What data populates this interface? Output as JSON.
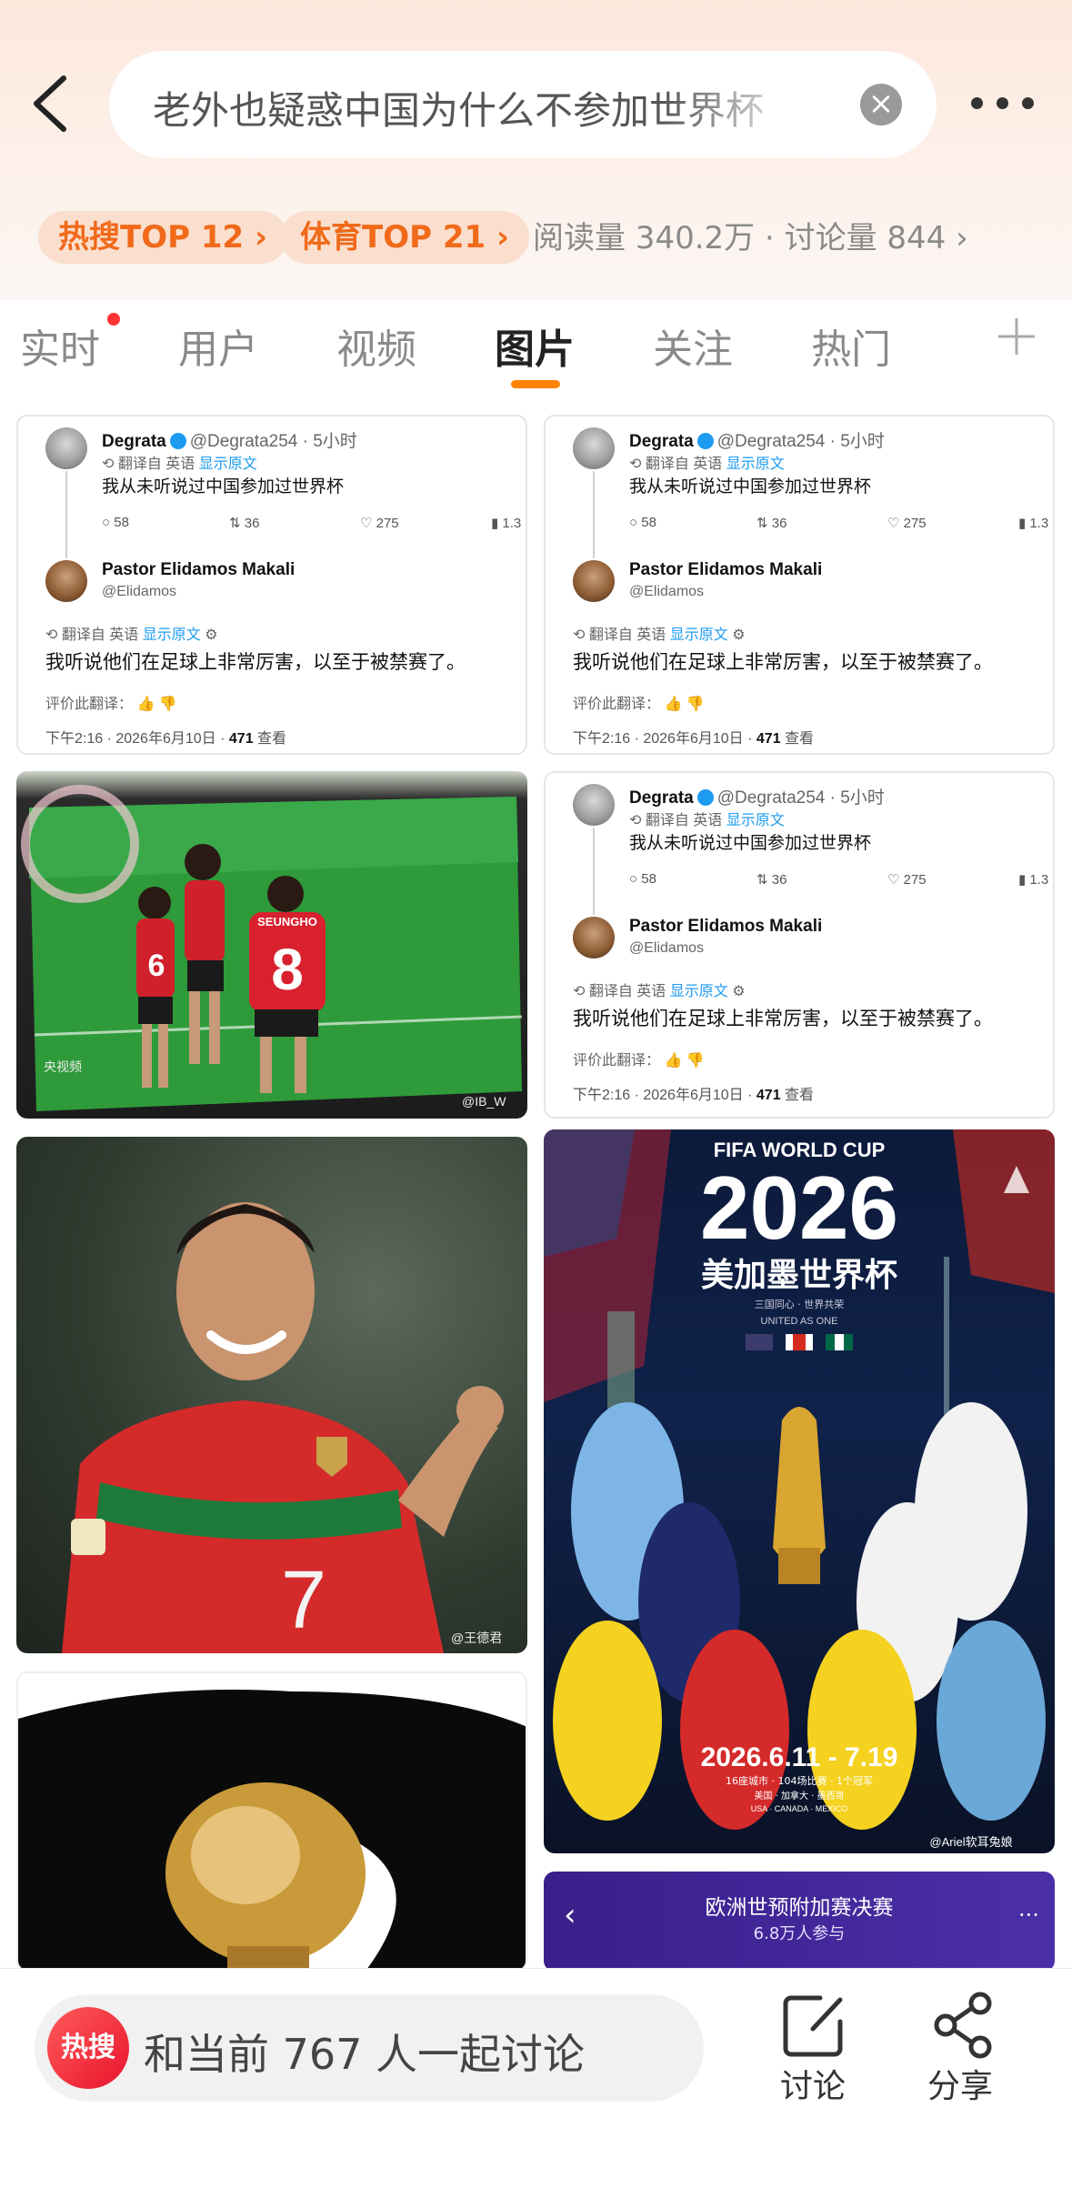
{
  "search": {
    "query": "老外也疑惑中国为什么不参加世界杯"
  },
  "tags": {
    "hot_search": "热搜TOP 12",
    "sports": "体育TOP 21"
  },
  "stats": "阅读量 340.2万 · 讨论量 844",
  "tabs": [
    "实时",
    "用户",
    "视频",
    "图片",
    "关注",
    "热门"
  ],
  "active_tab": "图片",
  "tweet": {
    "user1_name": "Degrata",
    "user1_handle": "@Degrata254 · 5小时",
    "translated_label": "翻译自 英语",
    "show_original": "显示原文",
    "text1": "我从未听说过中国参加过世界杯",
    "replies": "58",
    "retweets": "36",
    "likes": "275",
    "views": "1.3",
    "user2_name": "Pastor Elidamos Makali",
    "user2_handle": "@Elidamos",
    "text2": "我听说他们在足球上非常厉害，以至于被禁赛了。",
    "rate": "评价此翻译：",
    "time": "下午2:16 · 2026年6月10日 ·",
    "view_count": "471",
    "view_label": "查看"
  },
  "images": {
    "soccer_watermark": "央视频",
    "soccer_credit": "@IB_W",
    "jersey_name": "SEUNGHO",
    "jersey_number_a": "8",
    "jersey_number_b": "6",
    "ronaldo_number": "7",
    "ronaldo_credit": "@王德君",
    "poster_title": "FIFA WORLD CUP",
    "poster_year": "2026",
    "poster_sub": "美加墨世界杯",
    "poster_slogan": "三国同心 · 世界共荣",
    "poster_slogan_en": "UNITED AS ONE",
    "poster_dates": "2026.6.11 - 7.19",
    "poster_info": "16座城市 · 104场比赛 · 1个冠军",
    "poster_countries": "美国 · 加拿大 · 墨西哥",
    "poster_countries_en": "USA · CANADA · MEXICO",
    "poster_credit": "@Ariel软耳兔娘",
    "qualifier_title": "欧洲世预附加赛决赛",
    "qualifier_sub": "6.8万人参与"
  },
  "bottom": {
    "logo": "热搜",
    "discuss_prompt": "和当前 767 人一起讨论",
    "discuss_label": "讨论",
    "share_label": "分享"
  }
}
